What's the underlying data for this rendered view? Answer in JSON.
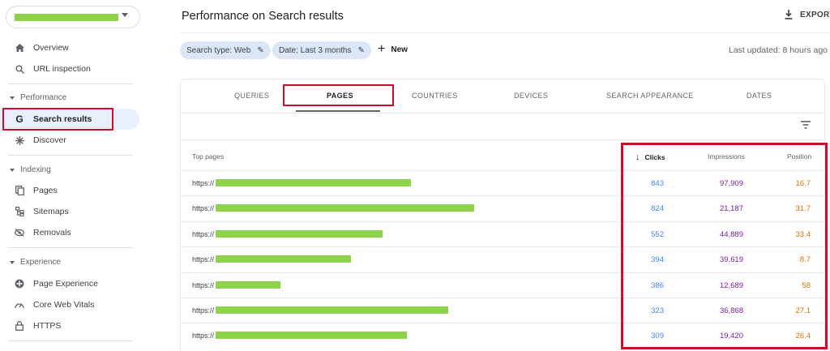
{
  "sidebar": {
    "items": [
      {
        "label": "Overview",
        "icon": "home-icon"
      },
      {
        "label": "URL inspection",
        "icon": "search-icon"
      }
    ],
    "sections": [
      {
        "label": "Performance",
        "items": [
          {
            "label": "Search results",
            "icon": "google-icon",
            "active": true
          },
          {
            "label": "Discover",
            "icon": "asterisk-icon"
          }
        ]
      },
      {
        "label": "Indexing",
        "items": [
          {
            "label": "Pages",
            "icon": "pages-icon"
          },
          {
            "label": "Sitemaps",
            "icon": "sitemap-icon"
          },
          {
            "label": "Removals",
            "icon": "removal-icon"
          }
        ]
      },
      {
        "label": "Experience",
        "items": [
          {
            "label": "Page Experience",
            "icon": "page-experience-icon"
          },
          {
            "label": "Core Web Vitals",
            "icon": "gauge-icon"
          },
          {
            "label": "HTTPS",
            "icon": "lock-icon"
          }
        ]
      }
    ]
  },
  "header": {
    "title": "Performance on Search results",
    "export_label": "EXPORT",
    "last_updated": "Last updated: 8 hours ago"
  },
  "filters": {
    "chips": [
      "Search type: Web",
      "Date: Last 3 months"
    ],
    "new_label": "New"
  },
  "tabs": [
    "QUERIES",
    "PAGES",
    "COUNTRIES",
    "DEVICES",
    "SEARCH APPEARANCE",
    "DATES"
  ],
  "active_tab": "PAGES",
  "table": {
    "headers": {
      "pages": "Top pages",
      "clicks": "Clicks",
      "impressions": "Impressions",
      "position": "Position"
    },
    "rows": [
      {
        "url": "https://",
        "clicks": "843",
        "impressions": "97,909",
        "position": "16.7"
      },
      {
        "url": "https://",
        "clicks": "824",
        "impressions": "21,187",
        "position": "31.7"
      },
      {
        "url": "https://",
        "clicks": "552",
        "impressions": "44,889",
        "position": "33.4"
      },
      {
        "url": "https://",
        "clicks": "394",
        "impressions": "39,619",
        "position": "8.7"
      },
      {
        "url": "https://",
        "clicks": "386",
        "impressions": "12,689",
        "position": "58"
      },
      {
        "url": "https://",
        "clicks": "323",
        "impressions": "36,868",
        "position": "27.1"
      },
      {
        "url": "https://",
        "clicks": "309",
        "impressions": "19,420",
        "position": "26.4"
      }
    ]
  },
  "colors": {
    "clicks": "#4285f4",
    "impressions": "#7b1fa2",
    "position": "#e37400",
    "highlight": "#c8102e",
    "redaction": "#8dd34b"
  }
}
